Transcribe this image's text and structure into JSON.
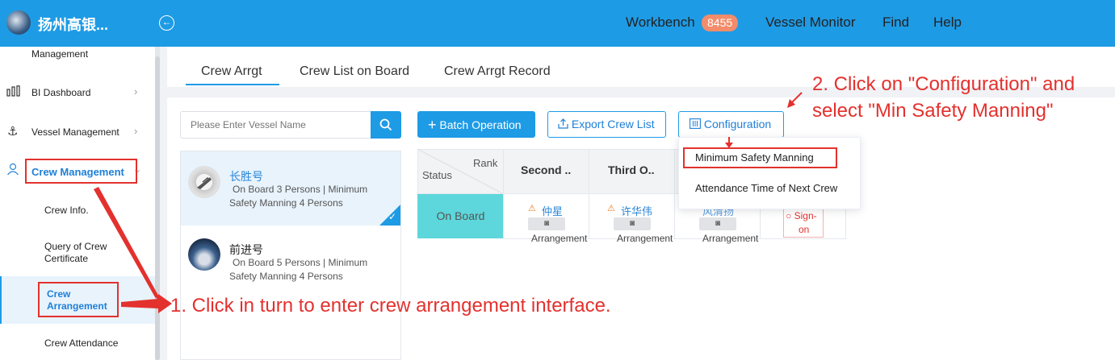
{
  "header": {
    "app_title": "扬州高银...",
    "collapse_icon": "arrow-left-circle-icon",
    "nav": {
      "workbench": "Workbench",
      "workbench_badge": "8455",
      "vessel_monitor": "Vessel Monitor",
      "find": "Find",
      "help": "Help"
    }
  },
  "sidebar": {
    "management_label": "Management",
    "items": [
      {
        "label": "BI Dashboard",
        "icon": "bar-chart-icon"
      },
      {
        "label": "Vessel Management",
        "icon": "anchor-icon"
      },
      {
        "label": "Crew Management",
        "icon": "user-icon"
      }
    ],
    "sub_items": [
      {
        "label": "Crew Info."
      },
      {
        "label": "Query of Crew Certificate"
      },
      {
        "label": "Crew Arrangement"
      },
      {
        "label": "Crew Attendance"
      }
    ]
  },
  "tabs": [
    {
      "label": "Crew Arrgt"
    },
    {
      "label": "Crew List on Board"
    },
    {
      "label": "Crew Arrgt Record"
    }
  ],
  "search": {
    "placeholder": "Please Enter Vessel Name"
  },
  "vessels": [
    {
      "name": "长胜号",
      "info_line1": "On Board 3 Persons | Minimum",
      "info_line2": "Safety Manning 4 Persons"
    },
    {
      "name": "前进号",
      "info_line1": "On Board 5 Persons | Minimum",
      "info_line2": "Safety Manning 4 Persons"
    }
  ],
  "toolbar": {
    "batch": "Batch Operation",
    "export": "Export Crew List",
    "config": "Configuration"
  },
  "table": {
    "rank_label": "Rank",
    "status_label": "Status",
    "columns": [
      "Second ..",
      "Third O.."
    ],
    "row_status": "On Board",
    "crew": [
      "仲星",
      "许华伟",
      "风清扬"
    ],
    "arrangement_label": "Arrangement",
    "sign_on_line1": "Sign-",
    "sign_on_line2": "on"
  },
  "dropdown": {
    "items": [
      "Minimum Safety Manning",
      "Attendance Time of Next Crew"
    ]
  },
  "annotations": {
    "step1": "1. Click in turn to enter crew arrangement interface.",
    "step2_line1": "2. Click on \"Configuration\" and",
    "step2_line2": "select \"Min Safety Manning\""
  },
  "colors": {
    "primary": "#1e9be5",
    "annotation": "#e3312e",
    "on_board": "#5dd7db"
  }
}
